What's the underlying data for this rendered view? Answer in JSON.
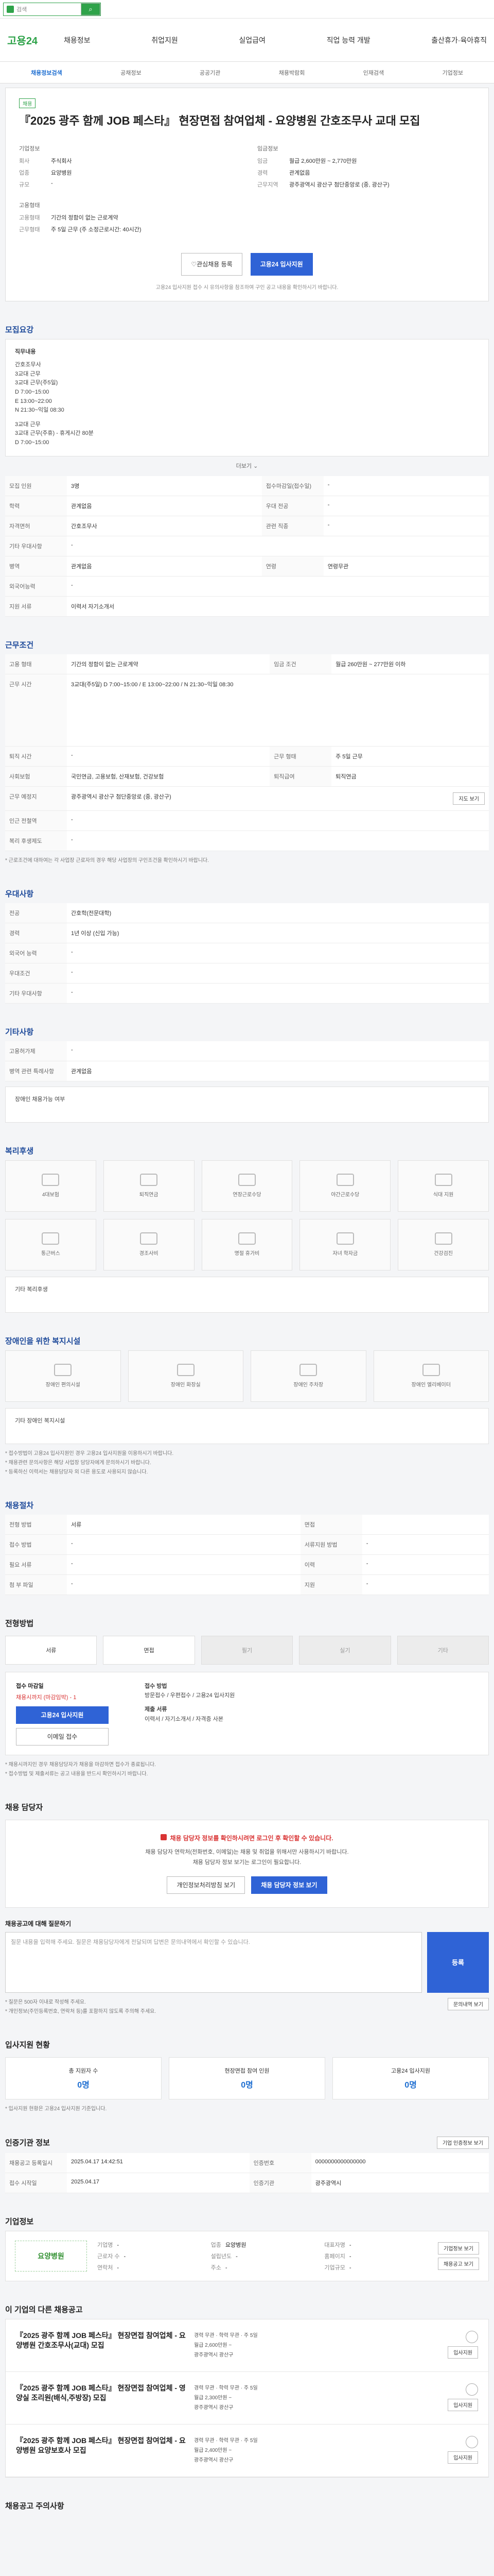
{
  "topbar": {
    "search_placeholder": "검색"
  },
  "gnb": {
    "brand_a": "고용",
    "brand_b": "24",
    "menu": [
      "채용정보",
      "취업지원",
      "실업급여",
      "직업 능력 개발",
      "출산휴가·육아휴직"
    ]
  },
  "snb": [
    "채용정보검색",
    "공채정보",
    "공공기관",
    "채용박람회",
    "인재검색",
    "기업정보"
  ],
  "job": {
    "badge": "채용",
    "title": "『2025 광주 함께 JOB 페스타』 현장면접 참여업체 - 요양병원 간호조무사 교대 모집",
    "company_label": "기업정보",
    "company_rows": [
      [
        "회사",
        "주식회사"
      ],
      [
        "업종",
        "요양병원"
      ],
      [
        "규모",
        "-"
      ]
    ],
    "cond_label": "고용형태",
    "cond_rows": [
      [
        "고용형태",
        "기간의 정함이 없는 근로계약"
      ],
      [
        "근무형태",
        "주 5일 근무 (주 소정근로시간: 40시간)"
      ]
    ],
    "right_label": "임금정보",
    "right_rows": [
      [
        "임금",
        "월급 2,600만원 ~ 2,770만원"
      ],
      [
        "경력",
        "관계없음"
      ],
      [
        "근무지역",
        "광주광역시 광산구 첨단중앙로 (중, 광산구)"
      ]
    ],
    "btn_save": "관심채용 등록",
    "btn_apply": "고용24 입사지원",
    "notice": "고용24 입사지원 접수 시 유의사항을 참조하여 구인 공고 내용을 확인하시기 바랍니다."
  },
  "sec_recruit": {
    "title": "모집요강",
    "desc_title": "직무내용",
    "desc_lines": [
      "간호조무사",
      "3교대 근무",
      "3교대 근무(주5일)",
      "D 7:00~15:00",
      "E 13:00~22:00",
      "N 21:30~익일 08:30",
      "",
      "3교대 근무",
      "3교대 근무(주휴) - 휴게시간 80분",
      "D 7:00~15:00"
    ],
    "more": "더보기",
    "rows": [
      [
        "모집 인원",
        "3명",
        "접수마감일(접수일)",
        "-"
      ],
      [
        "학력",
        "관계없음",
        "우대 전공",
        "-"
      ],
      [
        "자격면허",
        "간호조무사",
        "관련 직종",
        "-"
      ],
      [
        "기타 우대사항",
        "-",
        "",
        ""
      ],
      [
        "병역",
        "관계없음",
        "연령",
        "연령무관"
      ],
      [
        "외국어능력",
        "-",
        "",
        ""
      ],
      [
        "지원 서류",
        "이력서 자기소개서",
        "",
        ""
      ]
    ]
  },
  "sec_cond": {
    "title": "근무조건",
    "rows": [
      [
        "고용 형태",
        "기간의 정함이 없는 근로계약",
        "임금 조건",
        "월급 260만원 ~ 277만원 이하"
      ],
      [
        "근무 시간",
        "3교대(주5일) D 7:00~15:00 / E 13:00~22:00 / N 21:30~익일 08:30",
        "",
        ""
      ],
      [
        "퇴직 시간",
        "-",
        "근무 형태",
        "주 5일 근무"
      ],
      [
        "사회보험",
        "국민연금, 고용보험, 산재보험, 건강보험",
        "퇴직급여",
        "퇴직연금"
      ],
      [
        "근무 예정지",
        "광주광역시 광산구 첨단중앙로 (중, 광산구)",
        "",
        ""
      ],
      [
        "인근 전철역",
        "-",
        "",
        ""
      ],
      [
        "복리 후생제도",
        "-",
        "",
        ""
      ]
    ],
    "map_btn": "지도 보기",
    "notice": "* 근로조건에 대하여는 각 사업장 근로자의 경우 해당 사업장의 구인조건을 확인하시기 바랍니다."
  },
  "sec_pref": {
    "title": "우대사항",
    "rows": [
      [
        "전공",
        "간호학(전문대학)"
      ],
      [
        "경력",
        "1년 이상 (신입 가능)"
      ],
      [
        "외국어 능력",
        "-"
      ],
      [
        "우대조건",
        "-"
      ],
      [
        "기타 우대사항",
        "-"
      ]
    ]
  },
  "sec_etc": {
    "title": "기타사항",
    "rows": [
      [
        "고용허가제",
        "-"
      ],
      [
        "병역 관련 특례사항",
        "관계없음"
      ]
    ],
    "extra_title": "장애인 채용가능 여부"
  },
  "sec_welfare": {
    "title": "복리후생",
    "items": [
      "4대보험",
      "퇴직연금",
      "연장근로수당",
      "야간근로수당",
      "식대 지원",
      "통근버스",
      "경조사비",
      "명절 휴가비",
      "자녀 학자금",
      "건강검진"
    ],
    "extra_title": "기타 복리후생"
  },
  "sec_disabled": {
    "title": "장애인을 위한 복지시설",
    "items": [
      "장애인 편의시설",
      "장애인 화장실",
      "장애인 주차장",
      "장애인 엘리베이터"
    ],
    "extra_title": "기타 장애인 복지시설"
  },
  "sec_work": {
    "title": "채용절차",
    "rows": [
      [
        "전형 방법",
        "서류",
        "면접",
        ""
      ],
      [
        "접수 방법",
        "-",
        "서류지원 방법",
        "-"
      ],
      [
        "필요 서류",
        "-",
        "이력",
        "-"
      ],
      [
        "첨 부 파일",
        "-",
        "지원",
        "-"
      ]
    ],
    "notes": [
      "* 접수방법이 고용24 입사지원인 경우 고용24 입사지원을 이용하시기 바랍니다.",
      "* 채용관련 문의사항은 해당 사업장 담당자에게 문의하시기 바랍니다.",
      "* 등록하신 이력서는 채용담당자 외 다른 용도로 사용되지 않습니다."
    ]
  },
  "sec_apply": {
    "title": "전형방법",
    "tabs": [
      "서류",
      "면접",
      "필기",
      "실기",
      "기타"
    ],
    "left_label": "접수 마감일",
    "deadline_label": "채용시까지 (마감임박) - 1",
    "apply_btn": "고용24 입사지원",
    "apply_btn2": "이메일 접수",
    "right_label": "접수 방법",
    "right_lines": [
      "방문접수 / 우편접수 / 고용24 입사지원",
      "제출 서류",
      "이력서 / 자기소개서 / 자격증 사본"
    ],
    "notes": [
      "* 채용시까지인 경우 채용담당자가 채용을 마감하면 접수가 종료됩니다.",
      "* 접수방법 및 제출서류는 공고 내용을 반드시 확인하시기 바랍니다."
    ]
  },
  "sec_contact": {
    "title": "채용 담당자",
    "line1": "채용 담당자 정보를 확인하시려면 로그인 후 확인할 수 있습니다.",
    "line2": "채용 담당자 연락처(전화번호, 이메일)는 채용 및 취업을 위해서만 사용하시기 바랍니다.",
    "line3": "채용 담당자 정보 보기는 로그인이 필요합니다.",
    "btn_a": "개인정보처리방침 보기",
    "btn_b": "채용 담당자 정보 보기",
    "qa_title": "채용공고에 대해 질문하기",
    "qa_placeholder": "질문 내용을 입력해 주세요. 질문은 채용담당자에게 전달되며 답변은 문의내역에서 확인할 수 있습니다.",
    "qa_submit": "등록",
    "qa_notes": [
      "* 질문은 500자 이내로 작성해 주세요.",
      "* 개인정보(주민등록번호, 연락처 등)를 포함하지 않도록 주의해 주세요."
    ],
    "qa_btn": "문의내역 보기"
  },
  "sec_stats": {
    "title": "입사지원 현황",
    "items": [
      [
        "총 지원자 수",
        "0명"
      ],
      [
        "현장면접 참여 인원",
        "0명"
      ],
      [
        "고용24 입사지원",
        "0명"
      ]
    ],
    "note": "* 입사지원 현황은 고용24 입사지원 기준입니다."
  },
  "sec_info": {
    "title": "인증기관 정보",
    "btn": "기업 인증정보 보기",
    "rows": [
      [
        "채용공고 등록일시",
        "2025.04.17 14:42:51",
        "인증번호",
        "0000000000000000"
      ],
      [
        "접수 시작일",
        "2025.04.17",
        "인증기관",
        "광주광역시"
      ]
    ]
  },
  "sec_company": {
    "title": "기업정보",
    "logo_text": "요양병원",
    "rows": [
      [
        "기업명",
        "-"
      ],
      [
        "업종",
        "요양병원"
      ],
      [
        "대표자명",
        "-"
      ],
      [
        "근로자 수",
        "-"
      ],
      [
        "설립년도",
        "-"
      ],
      [
        "홈페이지",
        "-"
      ],
      [
        "연락처",
        "-"
      ],
      [
        "주소",
        "-"
      ],
      [
        "기업규모",
        "-"
      ]
    ],
    "btn_a": "기업정보 보기",
    "btn_b": "채용공고 보기"
  },
  "sec_others": {
    "title": "이 기업의 다른 채용공고",
    "rows": [
      {
        "title": "『2025 광주 함께 JOB 페스타』 현장면접 참여업체 - 요양병원 간호조무사(교대) 모집",
        "meta": [
          "경력 무관 · 학력 무관 · 주 5일",
          "월급 2,600만원 ~",
          "광주광역시 광산구"
        ],
        "btn": "입사지원"
      },
      {
        "title": "『2025 광주 함께 JOB 페스타』 현장면접 참여업체 - 영양실 조리원(배식,주방장) 모집",
        "meta": [
          "경력 무관 · 학력 무관 · 주 5일",
          "월급 2,300만원 ~",
          "광주광역시 광산구"
        ],
        "btn": "입사지원"
      },
      {
        "title": "『2025 광주 함께 JOB 페스타』 현장면접 참여업체 - 요양병원 요양보호사 모집",
        "meta": [
          "경력 무관 · 학력 무관 · 주 5일",
          "월급 2,400만원 ~",
          "광주광역시 광산구"
        ],
        "btn": "입사지원"
      }
    ]
  },
  "sec_footer": {
    "title": "채용공고 주의사항"
  }
}
